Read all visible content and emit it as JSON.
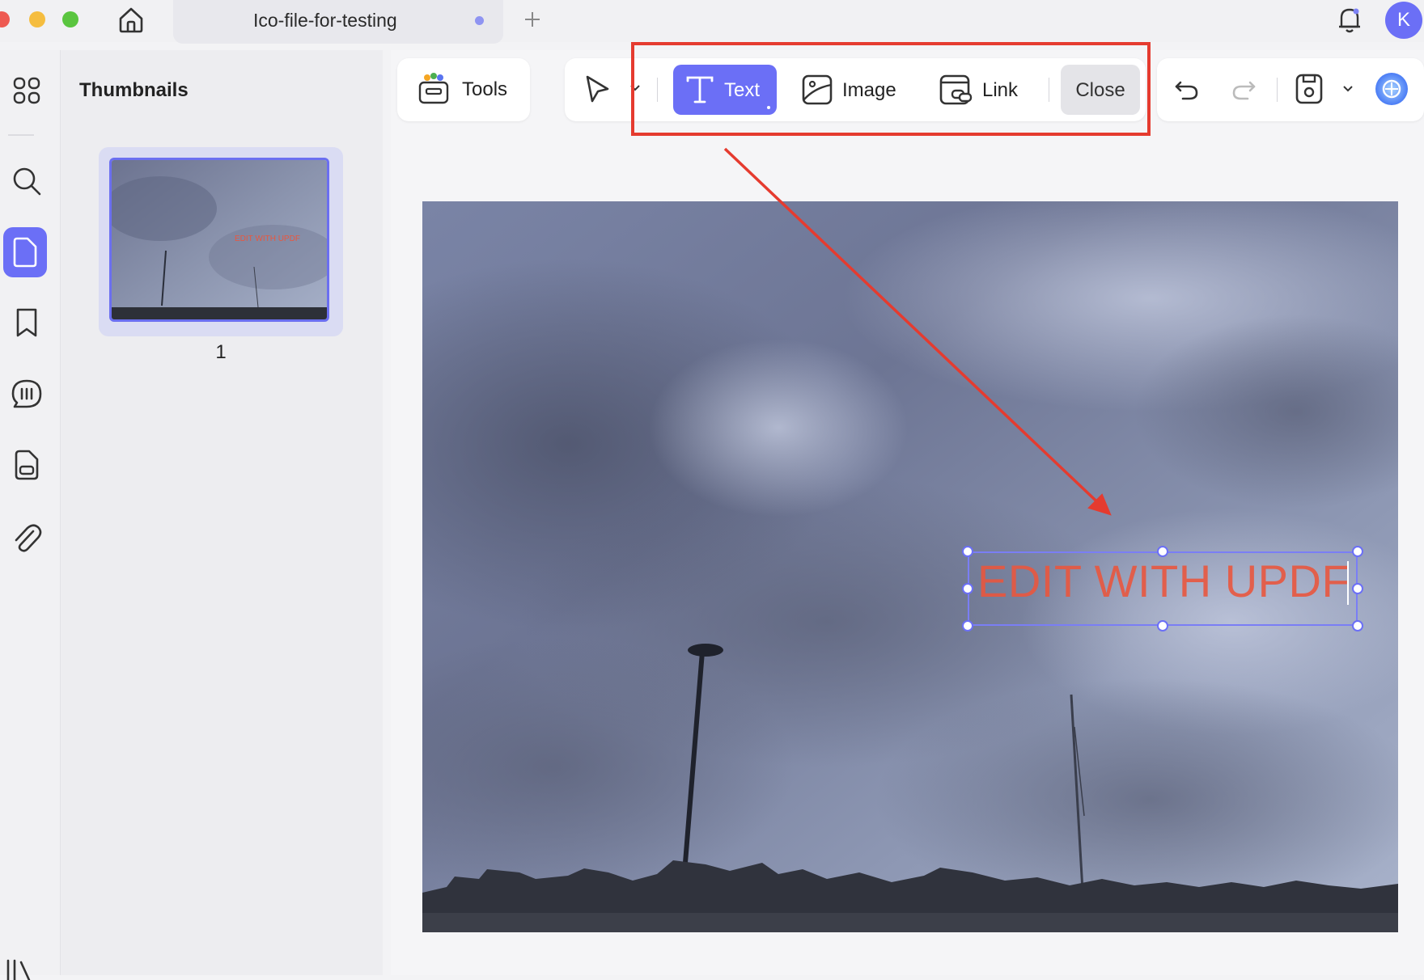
{
  "tab": {
    "title": "Ico-file-for-testing"
  },
  "account": {
    "initial": "K"
  },
  "thumbnails": {
    "title": "Thumbnails",
    "pages": [
      {
        "number": "1"
      }
    ]
  },
  "toolbar": {
    "tools_label": "Tools",
    "text_label": "Text",
    "image_label": "Image",
    "link_label": "Link",
    "close_label": "Close"
  },
  "canvas": {
    "text_box_content": "EDIT WITH UPDF",
    "thumb_text": "EDIT WITH UPDF"
  },
  "colors": {
    "accent": "#6b6ff6",
    "annotation": "#e53b2f",
    "text_box": "#e9573f"
  },
  "icons": [
    "home-icon",
    "plus-icon",
    "bell-icon",
    "thumbnails-grid-icon",
    "search-icon",
    "page-icon",
    "bookmark-icon",
    "comment-icon",
    "form-icon",
    "attachment-icon",
    "tools-icon",
    "pointer-icon",
    "text-icon",
    "image-icon",
    "link-icon",
    "undo-icon",
    "redo-icon",
    "save-icon",
    "ai-assistant-icon"
  ]
}
